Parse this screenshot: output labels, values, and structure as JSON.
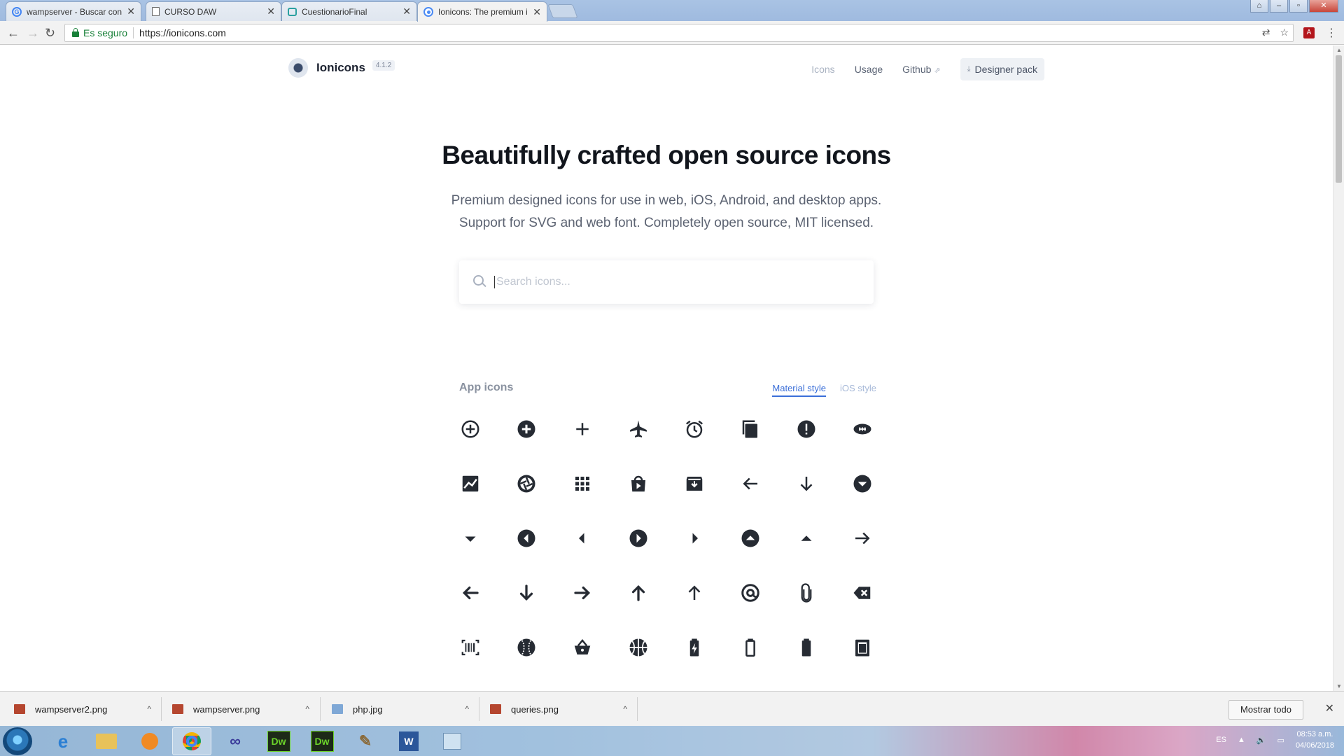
{
  "browser": {
    "tabs": [
      {
        "title": "wampserver - Buscar con",
        "favicon": "google-icon"
      },
      {
        "title": "CURSO DAW",
        "favicon": "document-icon"
      },
      {
        "title": "CuestionarioFinal",
        "favicon": "edmodo-icon"
      },
      {
        "title": "Ionicons: The premium ic",
        "favicon": "ionicons-icon"
      }
    ],
    "secure_label": "Es seguro",
    "url": "https://ionicons.com"
  },
  "site": {
    "brand": "Ionicons",
    "version": "4.1.2",
    "nav": {
      "icons": "Icons",
      "usage": "Usage",
      "github": "Github",
      "designer_pack": "Designer pack"
    }
  },
  "hero": {
    "title": "Beautifully crafted open source icons",
    "subtitle_line1": "Premium designed icons for use in web, iOS, Android, and desktop apps.",
    "subtitle_line2": "Support for SVG and web font. Completely open source, MIT licensed."
  },
  "search": {
    "placeholder": "Search icons...",
    "value": ""
  },
  "section": {
    "title": "App icons",
    "style_material": "Material style",
    "style_ios": "iOS style"
  },
  "icons": [
    "add-circle-outline-icon",
    "add-circle-icon",
    "add-icon",
    "airplane-icon",
    "alarm-icon",
    "albums-icon",
    "alert-icon",
    "american-football-icon",
    "analytics-icon",
    "aperture-icon",
    "apps-icon",
    "appstore-icon",
    "archive-icon",
    "arrow-back-icon",
    "arrow-down-icon",
    "arrow-dropdown-circle-icon",
    "arrow-dropdown-icon",
    "arrow-dropleft-circle-icon",
    "arrow-dropleft-icon",
    "arrow-dropright-circle-icon",
    "arrow-dropright-icon",
    "arrow-dropup-circle-icon",
    "arrow-dropup-icon",
    "arrow-forward-icon",
    "arrow-round-back-icon",
    "arrow-round-down-icon",
    "arrow-round-forward-icon",
    "arrow-round-up-icon",
    "arrow-up-icon",
    "at-icon",
    "attach-icon",
    "backspace-icon",
    "barcode-icon",
    "baseball-icon",
    "basket-icon",
    "basketball-icon",
    "battery-charging-icon",
    "battery-dead-icon",
    "battery-full-icon",
    "beaker-icon"
  ],
  "downloads": [
    {
      "name": "wampserver2.png"
    },
    {
      "name": "wampserver.png"
    },
    {
      "name": "php.jpg"
    },
    {
      "name": "queries.png"
    }
  ],
  "downloads_show_all": "Mostrar todo",
  "taskbar": {
    "language": "ES",
    "time": "08:53 a.m.",
    "date": "04/06/2018"
  }
}
